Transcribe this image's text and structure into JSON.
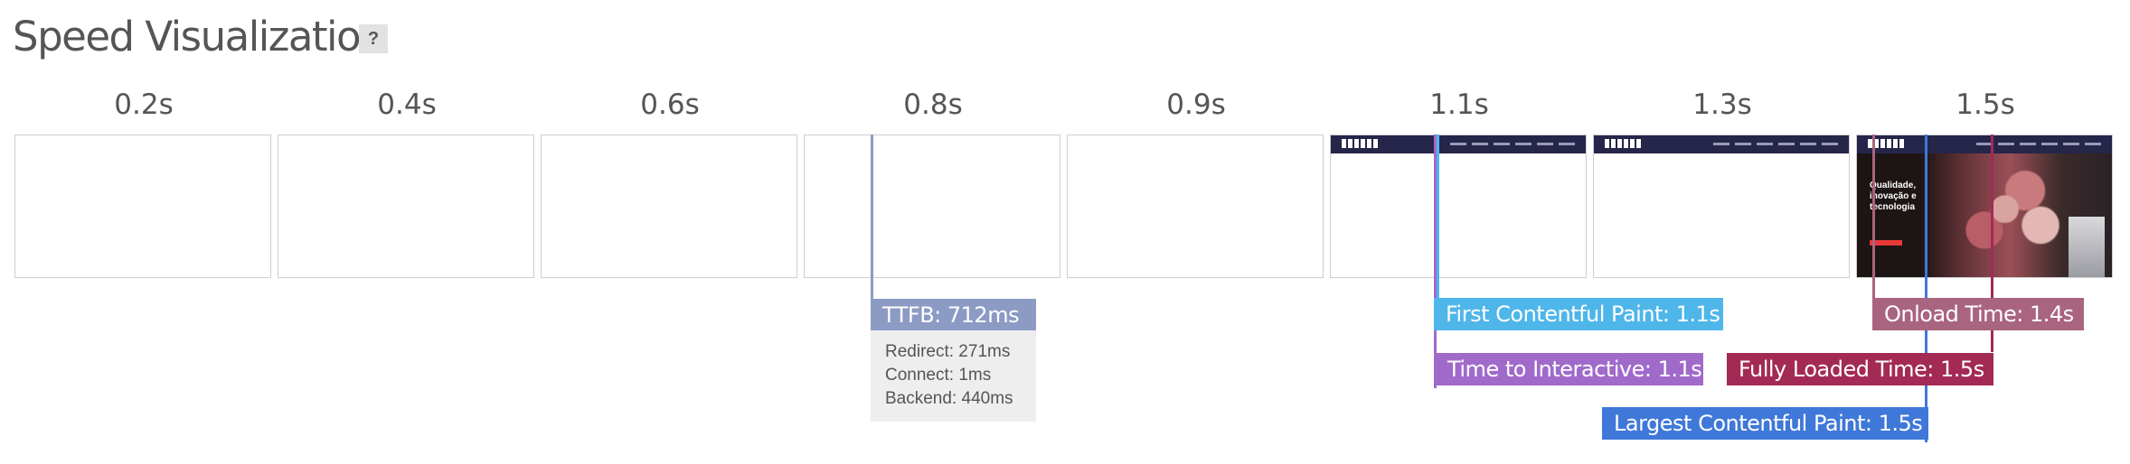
{
  "title": "Speed Visualization",
  "help_label": "?",
  "timeline": [
    "0.2s",
    "0.4s",
    "0.6s",
    "0.8s",
    "0.9s",
    "1.1s",
    "1.3s",
    "1.5s"
  ],
  "thumbnail": {
    "hero_text": "Qualidade, inovação e tecnologia"
  },
  "ttfb": {
    "label": "TTFB: 712ms",
    "details": [
      "Redirect: 271ms",
      "Connect: 1ms",
      "Backend: 440ms"
    ]
  },
  "metrics": {
    "first_contentful_paint": "First Contentful Paint: 1.1s",
    "time_to_interactive": "Time to Interactive: 1.1s",
    "largest_contentful_paint": "Largest Contentful Paint: 1.5s",
    "onload_time": "Onload Time: 1.4s",
    "fully_loaded_time": "Fully Loaded Time: 1.5s"
  },
  "colors": {
    "ttfb": "#8c9bc4",
    "first_contentful_paint": "#4fb6ea",
    "time_to_interactive": "#a06acb",
    "largest_contentful_paint": "#3f78d8",
    "onload_time": "#a9647f",
    "fully_loaded_time": "#a32a55"
  }
}
